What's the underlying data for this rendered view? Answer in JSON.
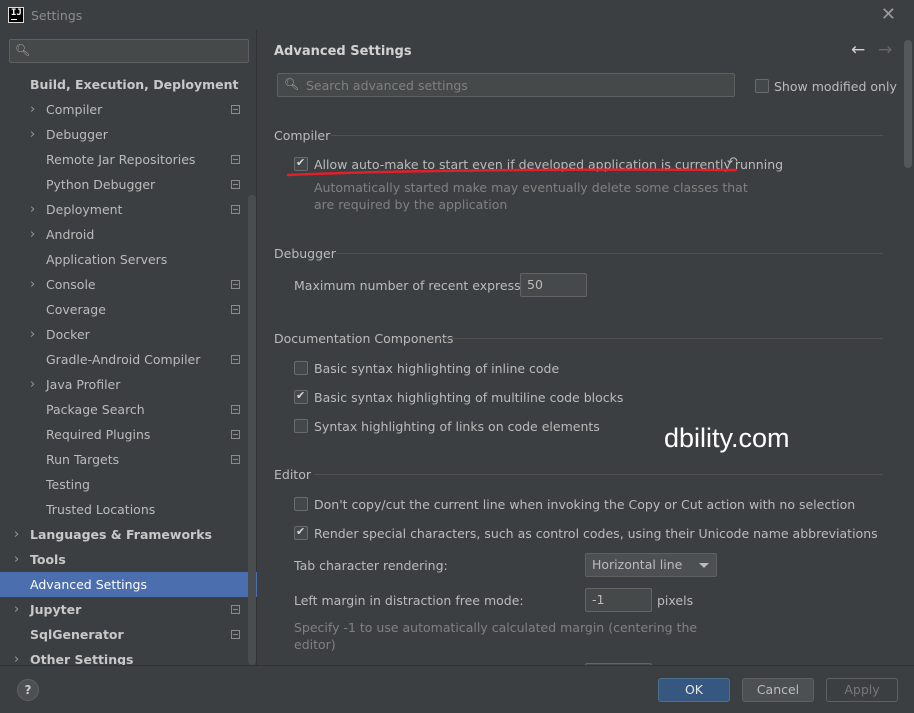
{
  "window": {
    "title": "Settings",
    "logo_text": "IJ"
  },
  "sidebar": {
    "search": {
      "placeholder": ""
    },
    "items": [
      {
        "label": "Build, Execution, Deployment",
        "level": 0,
        "arrow": false,
        "project": false,
        "bold": true
      },
      {
        "label": "Compiler",
        "level": 1,
        "arrow": true,
        "project": true
      },
      {
        "label": "Debugger",
        "level": 1,
        "arrow": true,
        "project": false
      },
      {
        "label": "Remote Jar Repositories",
        "level": 1,
        "arrow": false,
        "project": true
      },
      {
        "label": "Python Debugger",
        "level": 1,
        "arrow": false,
        "project": true
      },
      {
        "label": "Deployment",
        "level": 1,
        "arrow": true,
        "project": true
      },
      {
        "label": "Android",
        "level": 1,
        "arrow": true,
        "project": false
      },
      {
        "label": "Application Servers",
        "level": 1,
        "arrow": false,
        "project": false
      },
      {
        "label": "Console",
        "level": 1,
        "arrow": true,
        "project": true
      },
      {
        "label": "Coverage",
        "level": 1,
        "arrow": false,
        "project": true
      },
      {
        "label": "Docker",
        "level": 1,
        "arrow": true,
        "project": false
      },
      {
        "label": "Gradle-Android Compiler",
        "level": 1,
        "arrow": false,
        "project": true
      },
      {
        "label": "Java Profiler",
        "level": 1,
        "arrow": true,
        "project": false
      },
      {
        "label": "Package Search",
        "level": 1,
        "arrow": false,
        "project": true
      },
      {
        "label": "Required Plugins",
        "level": 1,
        "arrow": false,
        "project": true
      },
      {
        "label": "Run Targets",
        "level": 1,
        "arrow": false,
        "project": true
      },
      {
        "label": "Testing",
        "level": 1,
        "arrow": false,
        "project": false
      },
      {
        "label": "Trusted Locations",
        "level": 1,
        "arrow": false,
        "project": false
      },
      {
        "label": "Languages & Frameworks",
        "level": 0,
        "arrow": true,
        "project": false,
        "bold": true
      },
      {
        "label": "Tools",
        "level": 0,
        "arrow": true,
        "project": false,
        "bold": true
      },
      {
        "label": "Advanced Settings",
        "level": 0,
        "arrow": false,
        "project": false,
        "selected": true
      },
      {
        "label": "Jupyter",
        "level": 0,
        "arrow": true,
        "project": true,
        "bold": true
      },
      {
        "label": "SqlGenerator",
        "level": 0,
        "arrow": false,
        "project": true,
        "bold": true
      },
      {
        "label": "Other Settings",
        "level": 0,
        "arrow": true,
        "project": false,
        "bold": true
      }
    ]
  },
  "main": {
    "title": "Advanced Settings",
    "search_placeholder": "Search advanced settings",
    "show_modified_label": "Show modified only",
    "show_modified_checked": false,
    "sections": {
      "compiler": {
        "title": "Compiler",
        "automake_label": "Allow auto-make to start even if developed application is currently running",
        "automake_checked": true,
        "automake_desc_1": "Automatically started make may eventually delete some classes that",
        "automake_desc_2": "are required by the application"
      },
      "debugger": {
        "title": "Debugger",
        "max_expr_label": "Maximum number of recent expressions:",
        "max_expr_value": "50"
      },
      "documentation": {
        "title": "Documentation Components",
        "options": [
          {
            "label": "Basic syntax highlighting of inline code",
            "checked": false
          },
          {
            "label": "Basic syntax highlighting of multiline code blocks",
            "checked": true
          },
          {
            "label": "Syntax highlighting of links on code elements",
            "checked": false
          }
        ]
      },
      "editor": {
        "title": "Editor",
        "options": [
          {
            "label": "Don't copy/cut the current line when invoking the Copy or Cut action with no selection",
            "checked": false
          },
          {
            "label": "Render special characters, such as control codes, using their Unicode name abbreviations",
            "checked": true
          }
        ],
        "tab_render_label": "Tab character rendering:",
        "tab_render_value": "Horizontal line",
        "left_margin_label": "Left margin in distraction free mode:",
        "left_margin_value": "-1",
        "left_margin_unit": "pixels",
        "left_margin_help_1": "Specify -1 to use automatically calculated margin (centering the",
        "left_margin_help_2": "editor)"
      }
    },
    "watermark": "dbility.com"
  },
  "footer": {
    "help_label": "?",
    "ok_label": "OK",
    "cancel_label": "Cancel",
    "apply_label": "Apply"
  },
  "colors": {
    "background": "#3c3f41",
    "selection": "#4b6eaf",
    "ok_button": "#365880",
    "annotation_underline": "#e0202a"
  }
}
